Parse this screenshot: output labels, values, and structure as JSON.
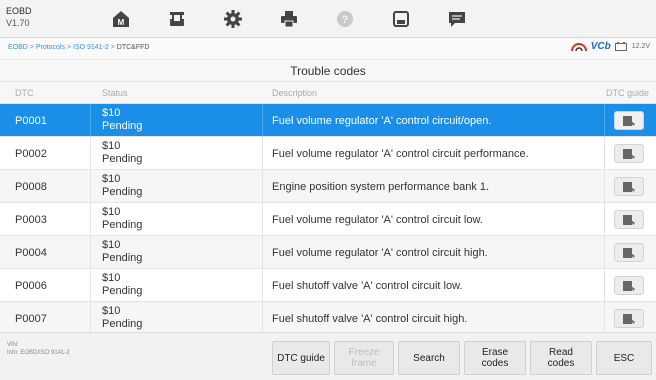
{
  "header": {
    "app_name": "EOBD",
    "version": "V1.70",
    "toolbar": [
      "home",
      "vehicle",
      "settings",
      "print",
      "help",
      "save",
      "data-logging"
    ]
  },
  "breadcrumb": {
    "p1": "EOBD",
    "p2": "Protocols",
    "p3": "ISO 9141-2",
    "current": "DTC&FFD",
    "sep": " > "
  },
  "status": {
    "vcb": "VCb",
    "voltage": "12.2V"
  },
  "page_title": "Trouble codes",
  "table": {
    "columns": [
      "DTC",
      "Status",
      "Description",
      "DTC guide"
    ],
    "rows": [
      {
        "code": "P0001",
        "status_code": "$10",
        "status": "Pending",
        "description": "Fuel volume regulator 'A' control circuit/open."
      },
      {
        "code": "P0002",
        "status_code": "$10",
        "status": "Pending",
        "description": "Fuel volume regulator 'A' control circuit performance."
      },
      {
        "code": "P0008",
        "status_code": "$10",
        "status": "Pending",
        "description": "Engine position system performance bank 1."
      },
      {
        "code": "P0003",
        "status_code": "$10",
        "status": "Pending",
        "description": "Fuel volume regulator 'A' control circuit low."
      },
      {
        "code": "P0004",
        "status_code": "$10",
        "status": "Pending",
        "description": "Fuel volume regulator 'A' control circuit high."
      },
      {
        "code": "P0006",
        "status_code": "$10",
        "status": "Pending",
        "description": "Fuel shutoff valve 'A' control circuit low."
      },
      {
        "code": "P0007",
        "status_code": "$10",
        "status": "Pending",
        "description": "Fuel shutoff valve 'A' control circuit high."
      }
    ],
    "selected_index": 0
  },
  "footer": {
    "vin_label": "VIN:",
    "info_label": "Info: EOBD/ISO 9141-2",
    "buttons": {
      "dtc_guide": "DTC guide",
      "freeze_frame": "Freeze frame",
      "search": "Search",
      "erase_codes": "Erase codes",
      "read_codes": "Read codes",
      "esc": "ESC"
    }
  },
  "colors": {
    "accent": "#1b8ee8",
    "link": "#3a8fd1",
    "vcb": "#2168b7",
    "vcb_arc": "#d9341f"
  }
}
